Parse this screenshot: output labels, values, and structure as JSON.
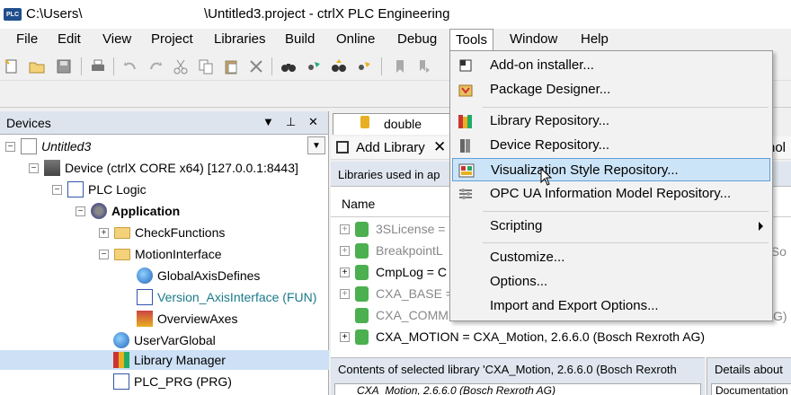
{
  "window": {
    "path_left": "C:\\Users\\",
    "path_right": "\\Untitled3.project - ctrlX PLC Engineering",
    "app_icon_text": "PLC"
  },
  "menubar": {
    "items": [
      {
        "label": "File"
      },
      {
        "label": "Edit"
      },
      {
        "label": "View"
      },
      {
        "label": "Project"
      },
      {
        "label": "Libraries"
      },
      {
        "label": "Build"
      },
      {
        "label": "Online"
      },
      {
        "label": "Debug"
      },
      {
        "label": "Tools"
      },
      {
        "label": "Window"
      },
      {
        "label": "Help"
      }
    ]
  },
  "tools_menu": {
    "items": [
      {
        "label": "Add-on installer...",
        "icon": "add-on-installer-icon"
      },
      {
        "label": "Package Designer...",
        "icon": "package-designer-icon"
      },
      {
        "label": "Library Repository...",
        "icon": "library-repository-icon"
      },
      {
        "label": "Device Repository...",
        "icon": "device-repository-icon"
      },
      {
        "label": "Visualization Style Repository...",
        "icon": "visualization-style-icon"
      },
      {
        "label": "OPC UA Information Model Repository...",
        "icon": "opc-ua-icon"
      },
      {
        "label": "Scripting",
        "icon": ""
      },
      {
        "label": "Customize...",
        "icon": ""
      },
      {
        "label": "Options...",
        "icon": ""
      },
      {
        "label": "Import and Export Options...",
        "icon": ""
      }
    ],
    "highlighted": "Visualization Style Repository..."
  },
  "devices": {
    "title": "Devices",
    "controls": {
      "dropdown": "▼",
      "pin": "⊥",
      "close": "✕"
    },
    "tree": [
      {
        "label": "Untitled3",
        "italic": true
      },
      {
        "label": "Device (ctrlX CORE x64) [127.0.0.1:8443]"
      },
      {
        "label": "PLC Logic"
      },
      {
        "label": "Application",
        "bold": true
      },
      {
        "label": "CheckFunctions"
      },
      {
        "label": "MotionInterface"
      },
      {
        "label": "GlobalAxisDefines"
      },
      {
        "label": "Version_AxisInterface (FUN)",
        "color": "#1a7a8a"
      },
      {
        "label": "OverviewAxes"
      },
      {
        "label": "UserVarGlobal"
      },
      {
        "label": "Library Manager"
      },
      {
        "label": "PLC_PRG (PRG)"
      }
    ]
  },
  "editor": {
    "tab_label": "double",
    "add_library": "Add Library",
    "libraries_header": "Libraries used in ap",
    "name_column": "Name",
    "right_fragments": {
      "hol": "hol",
      "tso": "t So",
      "g": "G)"
    },
    "libraries": [
      {
        "label": "3SLicense =",
        "gray": true
      },
      {
        "label": "BreakpointL",
        "gray": true
      },
      {
        "label": "CmpLog = C",
        "gray": false
      },
      {
        "label": "CXA_BASE =",
        "gray": true
      },
      {
        "label": "CXA_COMM",
        "gray": true
      },
      {
        "label": "CXA_MOTION = CXA_Motion, 2.6.6.0 (Bosch Rexroth AG)",
        "gray": false
      }
    ],
    "contents_header": "Contents of selected library 'CXA_Motion, 2.6.6.0 (Bosch Rexroth",
    "contents_row": "CXA_Motion, 2.6.6.0 (Bosch Rexroth AG)",
    "details_header": "Details about",
    "details_row": "Documentation"
  },
  "colors": {
    "menu_highlight": "#cce4f7",
    "panel_header": "#dde4ee",
    "accent_teal": "#1a7a8a"
  }
}
